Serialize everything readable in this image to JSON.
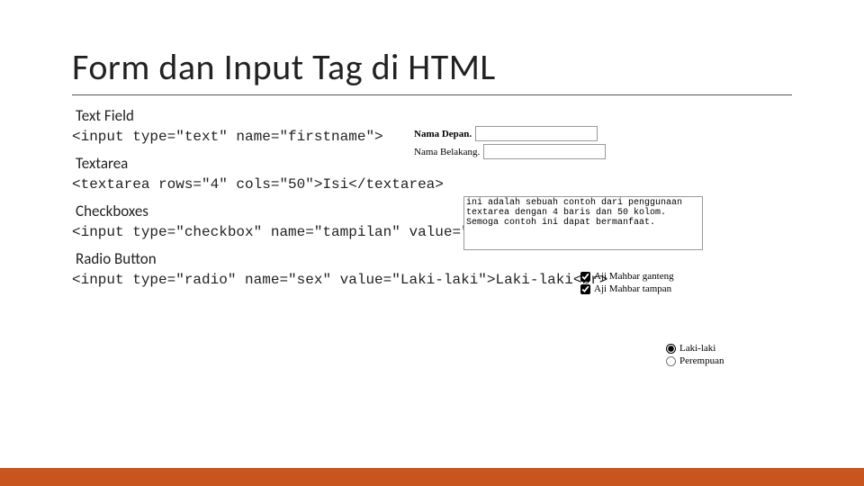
{
  "title": "Form dan Input Tag di HTML",
  "sections": {
    "text_field": {
      "heading": "Text Field",
      "code": "<input type=\"text\" name=\"firstname\">"
    },
    "textarea": {
      "heading": "Textarea",
      "code": "<textarea rows=\"4\" cols=\"50\">Isi</textarea>"
    },
    "checkboxes": {
      "heading": "Checkboxes",
      "code": "<input type=\"checkbox\" name=\"tampilan\" value=\"Ganteng\">"
    },
    "radio": {
      "heading": "Radio Button",
      "code": "<input type=\"radio\" name=\"sex\" value=\"Laki-laki\">Laki-laki<br>"
    }
  },
  "examples": {
    "text_field": {
      "label1": "Nama Depan.",
      "label2": "Nama Belakang."
    },
    "textarea_content": "ini adalah sebuah contoh dari penggunaan textarea dengan 4 baris dan 50 kolom. Semoga contoh ini dapat bermanfaat.",
    "checkboxes": {
      "opt1": "Aji Mahbar ganteng",
      "opt2": "Aji Mahbar tampan"
    },
    "radio": {
      "opt1": "Laki-laki",
      "opt2": "Perempuan"
    }
  }
}
